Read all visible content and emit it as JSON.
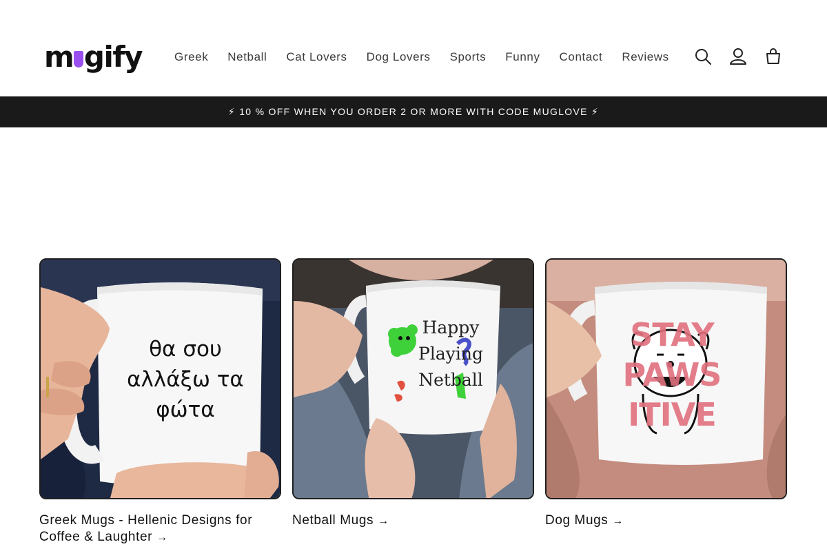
{
  "header": {
    "logo_text_left": "m",
    "logo_text_right": "gify",
    "nav": [
      {
        "label": "Greek"
      },
      {
        "label": "Netball"
      },
      {
        "label": "Cat Lovers"
      },
      {
        "label": "Dog Lovers"
      },
      {
        "label": "Sports"
      },
      {
        "label": "Funny"
      },
      {
        "label": "Contact"
      },
      {
        "label": "Reviews"
      }
    ],
    "icons": [
      "search-icon",
      "account-icon",
      "cart-icon"
    ]
  },
  "announcement": {
    "text": "⚡ 10 % OFF WHEN YOU ORDER 2 OR MORE WITH CODE MUGLOVE ⚡"
  },
  "collections": [
    {
      "title": "Greek Mugs - Hellenic Designs for Coffee & Laughter",
      "mug_text_lines": [
        "θα σου",
        "αλλάξω τα",
        "φώτα"
      ]
    },
    {
      "title": "Netball Mugs",
      "mug_text_lines": [
        "Happy",
        "Playing",
        "Netball"
      ]
    },
    {
      "title": "Dog Mugs",
      "mug_text_lines": [
        "STAY",
        "PAWS",
        "ITIVE"
      ]
    }
  ],
  "colors": {
    "announcement_bg": "#1a1a1a",
    "logo_accent": "#9a4ef0",
    "dog_print": "#e0707e"
  }
}
